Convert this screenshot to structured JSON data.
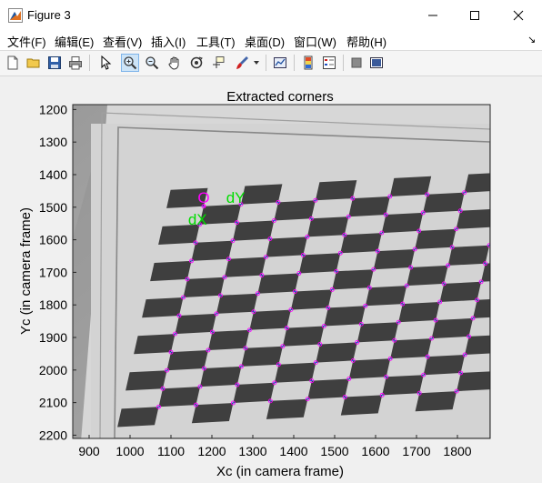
{
  "window": {
    "title": "Figure 3",
    "controls": {
      "minimize": "minimize",
      "maximize": "maximize",
      "close": "close"
    }
  },
  "menu": [
    "文件(F)",
    "编辑(E)",
    "查看(V)",
    "插入(I)",
    "工具(T)",
    "桌面(D)",
    "窗口(W)",
    "帮助(H)"
  ],
  "toolbar": {
    "buttons": [
      "new-figure-icon",
      "open-file-icon",
      "save-icon",
      "print-icon",
      "pointer-icon",
      "zoom-in-icon",
      "zoom-out-icon",
      "pan-icon",
      "rotate-3d-icon",
      "data-cursor-icon",
      "brush-icon",
      "brush-dropdown-icon",
      "link-plot-icon",
      "insert-colorbar-icon",
      "insert-legend-icon",
      "hide-plot-tools-icon",
      "show-plot-tools-icon"
    ],
    "active": "zoom-in-icon"
  },
  "chart_data": {
    "type": "scatter",
    "title": "Extracted corners",
    "xlabel": "Xc (in camera frame)",
    "ylabel": "Yc (in camera frame)",
    "xlim": [
      860,
      1880
    ],
    "ylim": [
      2210,
      1185
    ],
    "y_reversed": true,
    "xticks": [
      "900",
      "1000",
      "1100",
      "1200",
      "1300",
      "1400",
      "1500",
      "1600",
      "1700",
      "1800"
    ],
    "yticks": [
      "1200",
      "1300",
      "1400",
      "1500",
      "1600",
      "1700",
      "1800",
      "1900",
      "2000",
      "2100",
      "2200"
    ],
    "annotations": [
      {
        "text": "O",
        "x": 1180,
        "y": 1487,
        "color": "#ff00ff"
      },
      {
        "text": "dY",
        "x": 1258,
        "y": 1487,
        "color": "#00dd00"
      },
      {
        "text": "dX",
        "x": 1165,
        "y": 1553,
        "color": "#00dd00"
      }
    ],
    "marker_color": "#ff00ff",
    "grid_points": {
      "rows": 12,
      "cols": 11,
      "origin": [
        1180,
        1497
      ],
      "col_step": [
        91,
        -6
      ],
      "row_step": [
        -10,
        56
      ]
    }
  }
}
